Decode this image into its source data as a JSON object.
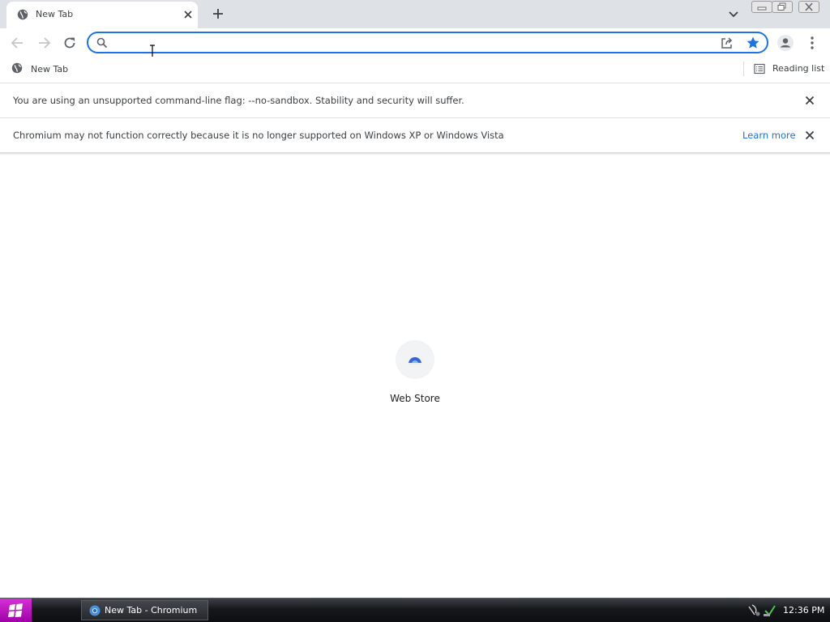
{
  "browser": {
    "tab": {
      "title": "New Tab"
    },
    "omnibox": {
      "value": "",
      "placeholder": ""
    },
    "bookmarks": [
      {
        "label": "New Tab"
      }
    ],
    "reading_list_label": "Reading list"
  },
  "infobars": [
    {
      "text": "You are using an unsupported command-line flag: --no-sandbox. Stability and security will suffer.",
      "link": ""
    },
    {
      "text": "Chromium may not function correctly because it is no longer supported on Windows XP or Windows Vista",
      "link": "Learn more"
    }
  ],
  "ntp": {
    "shortcuts": [
      {
        "label": "Web Store"
      }
    ]
  },
  "taskbar": {
    "task_label": "New Tab - Chromium",
    "clock": "12:36 PM"
  },
  "colors": {
    "accent": "#1a73e8",
    "tabstrip": "#dee1e6",
    "start_button": "#c020c8"
  }
}
